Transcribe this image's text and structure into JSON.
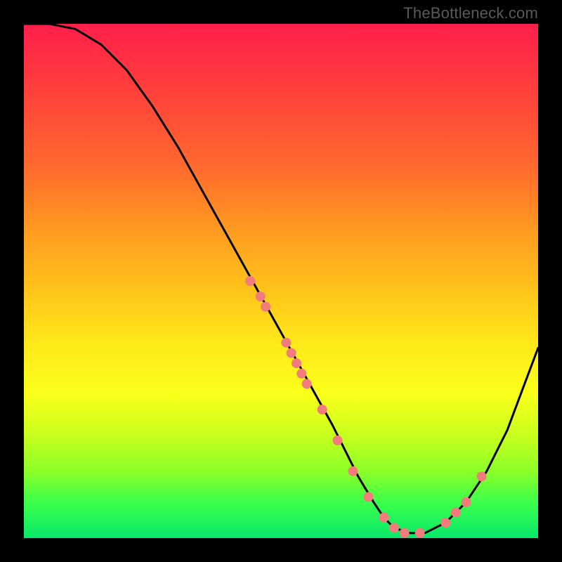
{
  "watermark": "TheBottleneck.com",
  "chart_data": {
    "type": "line",
    "title": "",
    "xlabel": "",
    "ylabel": "",
    "xlim": [
      0,
      100
    ],
    "ylim": [
      0,
      100
    ],
    "grid": false,
    "series": [
      {
        "name": "bottleneck-curve",
        "x": [
          0,
          5,
          10,
          15,
          20,
          25,
          30,
          35,
          40,
          45,
          50,
          55,
          60,
          62,
          65,
          68,
          70,
          72,
          75,
          78,
          82,
          86,
          90,
          94,
          97,
          100
        ],
        "values": [
          100,
          100,
          99,
          96,
          91,
          84,
          76,
          67,
          58,
          49,
          40,
          31,
          22,
          18,
          12,
          7,
          4,
          2,
          1,
          1,
          3,
          7,
          13,
          21,
          29,
          37
        ]
      }
    ],
    "markers": {
      "name": "highlight-dots",
      "color": "#f27b7b",
      "x": [
        44,
        46,
        47,
        51,
        52,
        53,
        54,
        55,
        58,
        61,
        64,
        67,
        70,
        72,
        74,
        77,
        82,
        84,
        86,
        89
      ],
      "values": [
        50,
        47,
        45,
        38,
        36,
        34,
        32,
        30,
        25,
        19,
        13,
        8,
        4,
        2,
        1,
        1,
        3,
        5,
        7,
        12
      ]
    },
    "background_gradient": {
      "top": "#ff1f4b",
      "bottom": "#07e86b"
    }
  }
}
